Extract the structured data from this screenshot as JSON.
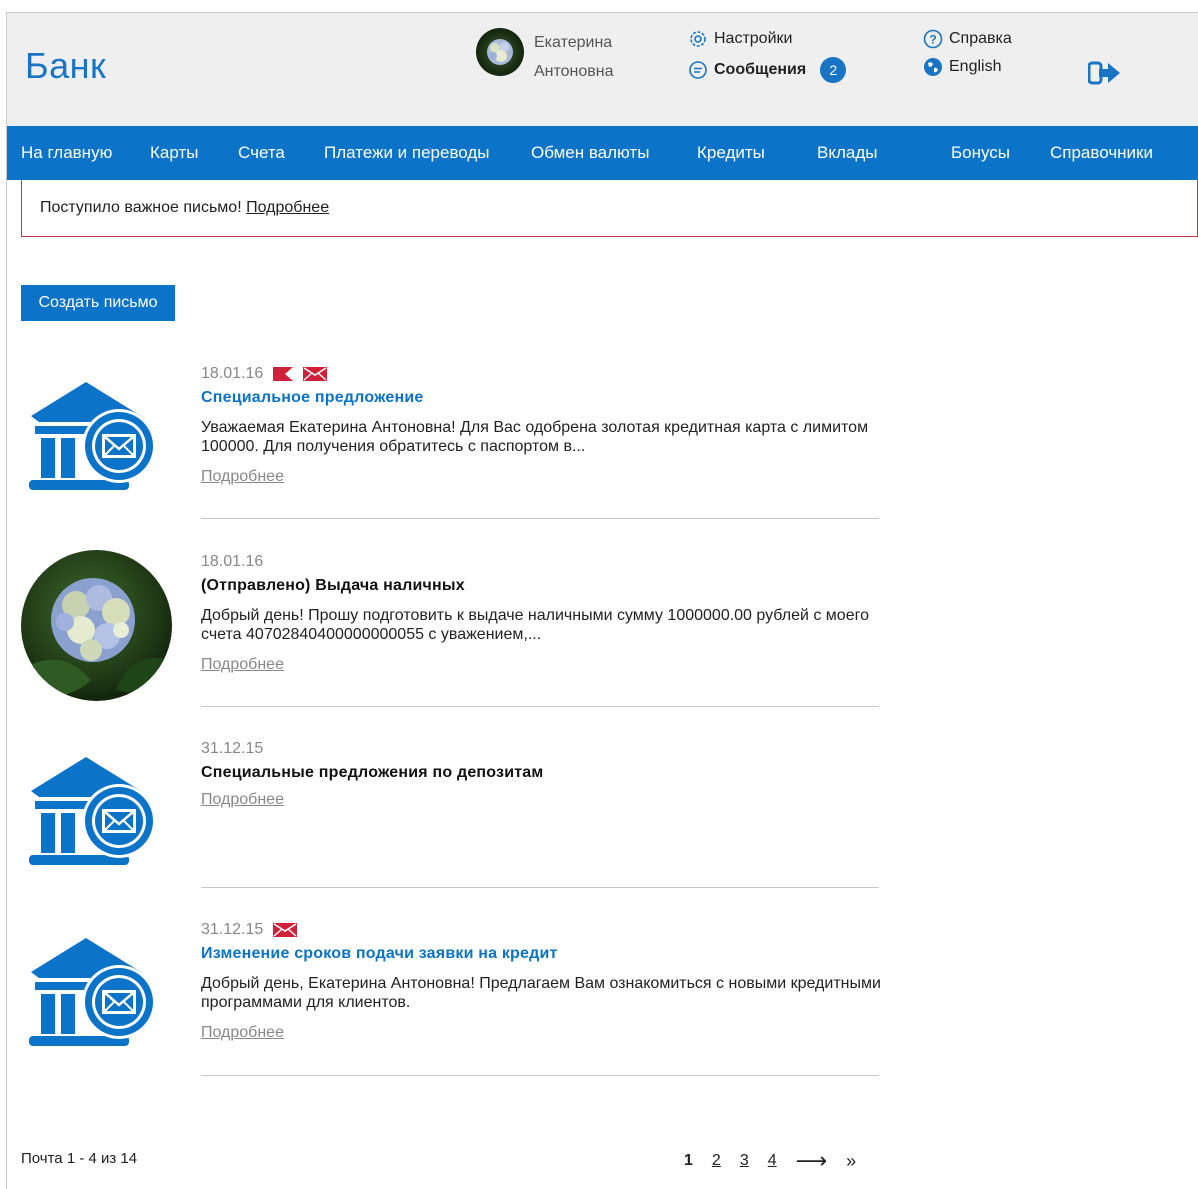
{
  "header": {
    "logo": "Банк",
    "user": {
      "first_name": "Екатерина",
      "last_name": "Антоновна"
    },
    "settings_label": "Настройки",
    "messages_label": "Сообщения",
    "messages_count": "2",
    "help_label": "Справка",
    "language_label": "English"
  },
  "nav": {
    "items": [
      {
        "label": "На главную"
      },
      {
        "label": "Карты"
      },
      {
        "label": "Счета"
      },
      {
        "label": "Платежи и переводы"
      },
      {
        "label": "Обмен валюты"
      },
      {
        "label": "Кредиты"
      },
      {
        "label": "Вклады"
      },
      {
        "label": "Бонусы"
      },
      {
        "label": "Справочники"
      }
    ]
  },
  "alert": {
    "text": "Поступило важное письмо!",
    "link": "Подробнее"
  },
  "create_button": "Создать письмо",
  "messages": [
    {
      "date": "18.01.16",
      "flagged": true,
      "unread": true,
      "title": "Специальное предложение",
      "text": "Уважаемая Екатерина Антоновна! Для Вас одобрена золотая кредитная карта с лимитом 100000. Для получения обратитесь с паспортом в...",
      "more": "Подробнее",
      "icon": "bank-mail-icon"
    },
    {
      "date": "18.01.16",
      "flagged": false,
      "unread": false,
      "title": "(Отправлено) Выдача наличных",
      "text": "Добрый день! Прошу подготовить к выдаче наличными сумму 1000000.00 рублей с моего счета 40702840400000000055 с уважением,...",
      "more": "Подробнее",
      "icon": "user-photo"
    },
    {
      "date": "31.12.15",
      "flagged": false,
      "unread": false,
      "title": "Специальные предложения по депозитам",
      "text": "",
      "more": "Подробнее",
      "icon": "bank-mail-icon"
    },
    {
      "date": "31.12.15",
      "flagged": false,
      "unread": true,
      "title": "Изменение сроков подачи заявки на кредит",
      "text": "Добрый день, Екатерина Антоновна! Предлагаем Вам ознакомиться с новыми кредитными программами для клиентов.",
      "more": "Подробнее",
      "icon": "bank-mail-icon"
    }
  ],
  "pagination": {
    "info": "Почта 1 - 4 из 14",
    "pages": [
      "1",
      "2",
      "3",
      "4"
    ],
    "current": "1",
    "next": "⟶",
    "last": "»"
  },
  "colors": {
    "brand": "#0b73c8",
    "alert_border": "#c5324a",
    "flag": "#d0203a"
  }
}
